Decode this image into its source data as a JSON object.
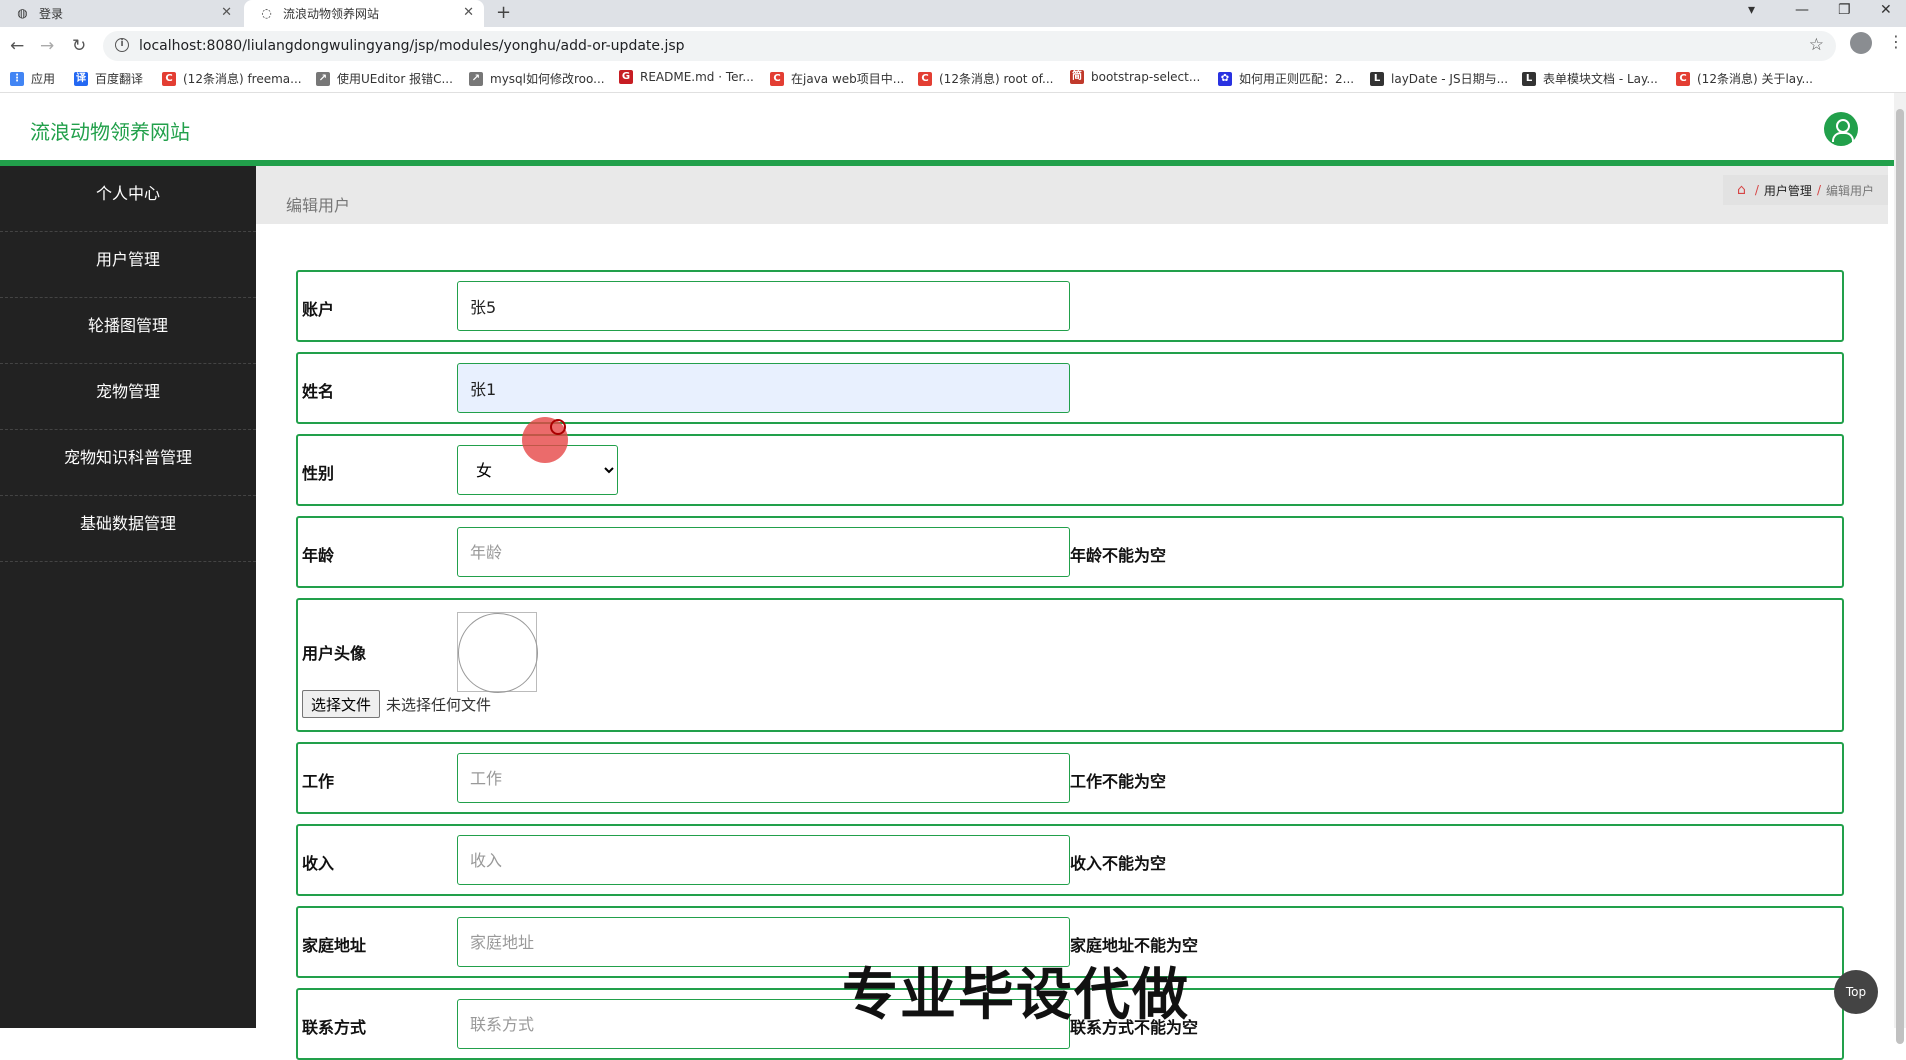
{
  "browser": {
    "tabs": [
      {
        "title": "登录"
      },
      {
        "title": "流浪动物领养网站"
      }
    ],
    "new_tab": "+",
    "url": "localhost:8080/liulangdongwulingyang/jsp/modules/yonghu/add-or-update.jsp",
    "bookmarks": [
      {
        "label": "应用",
        "icon": "apps-icon",
        "color": "#4285f4"
      },
      {
        "label": "百度翻译",
        "icon": "baidu-translate-icon",
        "color": "#2468f2"
      },
      {
        "label": "(12条消息) freema...",
        "icon": "csdn-icon",
        "color": "#e33e33"
      },
      {
        "label": "使用UEditor 报错C...",
        "icon": "link-icon",
        "color": "#777"
      },
      {
        "label": "mysql如何修改roo...",
        "icon": "link-icon",
        "color": "#777"
      },
      {
        "label": "README.md · Ter...",
        "icon": "gitee-icon",
        "color": "#c71d23"
      },
      {
        "label": "在java web项目中...",
        "icon": "csdn-icon",
        "color": "#e33e33"
      },
      {
        "label": "(12条消息) root of...",
        "icon": "csdn-icon",
        "color": "#e33e33"
      },
      {
        "label": "bootstrap-select...",
        "icon": "blog-icon",
        "color": "#c0392b"
      },
      {
        "label": "如何用正则匹配：2...",
        "icon": "baidu-icon",
        "color": "#2932e1"
      },
      {
        "label": "layDate - JS日期与...",
        "icon": "layui-icon",
        "color": "#333"
      },
      {
        "label": "表单模块文档 - Lay...",
        "icon": "layui-icon",
        "color": "#333"
      },
      {
        "label": "(12条消息) 关于lay...",
        "icon": "csdn-icon",
        "color": "#e33e33"
      }
    ]
  },
  "site": {
    "title": "流浪动物领养网站",
    "accent": "#22a04b"
  },
  "sidebar": {
    "items": [
      {
        "label": "个人中心"
      },
      {
        "label": "用户管理"
      },
      {
        "label": "轮播图管理"
      },
      {
        "label": "宠物管理"
      },
      {
        "label": "宠物知识科普管理"
      },
      {
        "label": "基础数据管理"
      }
    ]
  },
  "page": {
    "title": "编辑用户",
    "breadcrumb": {
      "parent": "用户管理",
      "current": "编辑用户",
      "sep": "/"
    }
  },
  "form": {
    "account": {
      "label": "账户",
      "value": "张5"
    },
    "name": {
      "label": "姓名",
      "value": "张1"
    },
    "gender": {
      "label": "性别",
      "selected": "女"
    },
    "age": {
      "label": "年龄",
      "placeholder": "年龄",
      "error": "年龄不能为空"
    },
    "avatar": {
      "label": "用户头像",
      "button": "选择文件",
      "file_status": "未选择任何文件"
    },
    "job": {
      "label": "工作",
      "placeholder": "工作",
      "error": "工作不能为空"
    },
    "income": {
      "label": "收入",
      "placeholder": "收入",
      "error": "收入不能为空"
    },
    "address": {
      "label": "家庭地址",
      "placeholder": "家庭地址",
      "error": "家庭地址不能为空"
    },
    "contact": {
      "label": "联系方式",
      "placeholder": "联系方式",
      "error": "联系方式不能为空"
    }
  },
  "overlay": {
    "watermark": "专业毕设代做",
    "top_button": "Top"
  }
}
